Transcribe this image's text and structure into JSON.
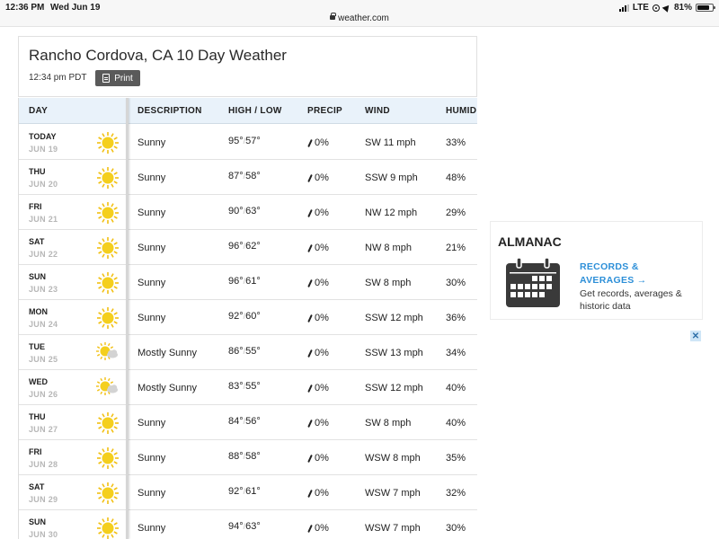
{
  "status_bar": {
    "time": "12:36 PM",
    "date": "Wed Jun 19",
    "url": "weather.com",
    "network": "LTE",
    "battery": "81%",
    "battery_level": 0.81
  },
  "header": {
    "title": "Rancho Cordova, CA 10 Day Weather",
    "updated": "12:34 pm PDT",
    "print_label": "Print"
  },
  "table": {
    "headers": {
      "day": "DAY",
      "description": "DESCRIPTION",
      "high_low": "HIGH / LOW",
      "precip": "PRECIP",
      "wind": "WIND",
      "humidity": "HUMID"
    },
    "rows": [
      {
        "day": "TODAY",
        "date": "JUN 19",
        "icon": "sun-icon",
        "desc": "Sunny",
        "high": "95°",
        "low": "57°",
        "precip": "0%",
        "wind": "SW 11 mph",
        "humidity": "33%"
      },
      {
        "day": "THU",
        "date": "JUN 20",
        "icon": "sun-icon",
        "desc": "Sunny",
        "high": "87°",
        "low": "58°",
        "precip": "0%",
        "wind": "SSW 9 mph",
        "humidity": "48%"
      },
      {
        "day": "FRI",
        "date": "JUN 21",
        "icon": "sun-icon",
        "desc": "Sunny",
        "high": "90°",
        "low": "63°",
        "precip": "0%",
        "wind": "NW 12 mph",
        "humidity": "29%"
      },
      {
        "day": "SAT",
        "date": "JUN 22",
        "icon": "sun-icon",
        "desc": "Sunny",
        "high": "96°",
        "low": "62°",
        "precip": "0%",
        "wind": "NW 8 mph",
        "humidity": "21%"
      },
      {
        "day": "SUN",
        "date": "JUN 23",
        "icon": "sun-icon",
        "desc": "Sunny",
        "high": "96°",
        "low": "61°",
        "precip": "0%",
        "wind": "SW 8 mph",
        "humidity": "30%"
      },
      {
        "day": "MON",
        "date": "JUN 24",
        "icon": "sun-icon",
        "desc": "Sunny",
        "high": "92°",
        "low": "60°",
        "precip": "0%",
        "wind": "SSW 12 mph",
        "humidity": "36%"
      },
      {
        "day": "TUE",
        "date": "JUN 25",
        "icon": "sun-cloud-icon",
        "desc": "Mostly Sunny",
        "high": "86°",
        "low": "55°",
        "precip": "0%",
        "wind": "SSW 13 mph",
        "humidity": "34%"
      },
      {
        "day": "WED",
        "date": "JUN 26",
        "icon": "sun-cloud-icon",
        "desc": "Mostly Sunny",
        "high": "83°",
        "low": "55°",
        "precip": "0%",
        "wind": "SSW 12 mph",
        "humidity": "40%"
      },
      {
        "day": "THU",
        "date": "JUN 27",
        "icon": "sun-icon",
        "desc": "Sunny",
        "high": "84°",
        "low": "56°",
        "precip": "0%",
        "wind": "SW 8 mph",
        "humidity": "40%"
      },
      {
        "day": "FRI",
        "date": "JUN 28",
        "icon": "sun-icon",
        "desc": "Sunny",
        "high": "88°",
        "low": "58°",
        "precip": "0%",
        "wind": "WSW 8 mph",
        "humidity": "35%"
      },
      {
        "day": "SAT",
        "date": "JUN 29",
        "icon": "sun-icon",
        "desc": "Sunny",
        "high": "92°",
        "low": "61°",
        "precip": "0%",
        "wind": "WSW 7 mph",
        "humidity": "32%"
      },
      {
        "day": "SUN",
        "date": "JUN 30",
        "icon": "sun-icon",
        "desc": "Sunny",
        "high": "94°",
        "low": "63°",
        "precip": "0%",
        "wind": "WSW 7 mph",
        "humidity": "30%"
      }
    ]
  },
  "almanac": {
    "title": "ALMANAC",
    "link_line1": "RECORDS &",
    "link_line2": "AVERAGES →",
    "desc_line1": "Get records, averages &",
    "desc_line2": "historic data"
  },
  "ad_close": "✕",
  "colors": {
    "header_bg": "#e9f2fa",
    "sun_yellow": "#f2c012",
    "link_blue": "#2d8fd8",
    "print_btn": "#5a5a5a"
  }
}
